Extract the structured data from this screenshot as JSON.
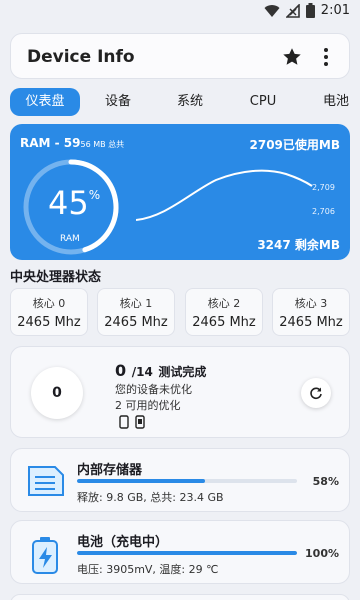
{
  "status_bar": {
    "time": "2:01"
  },
  "app_bar": {
    "title": "Device Info"
  },
  "tabs": [
    {
      "label": "仪表盘",
      "active": true
    },
    {
      "label": "设备",
      "active": false
    },
    {
      "label": "系统",
      "active": false
    },
    {
      "label": "CPU",
      "active": false
    },
    {
      "label": "电池",
      "active": false
    }
  ],
  "ram": {
    "label": "RAM - 59",
    "total_suffix": "56 MB 总共",
    "used_value": "2709",
    "used_unit": "已使用MB",
    "free_value": "3247",
    "free_unit": "剩余MB",
    "percent": "45",
    "percent_sign": "%",
    "gauge_fraction": 0.45,
    "tag": "RAM",
    "axis_top": "2,709",
    "axis_bottom": "2,706"
  },
  "cpu_section": {
    "title": "中央处理器状态",
    "cores": [
      {
        "label": "核心 0",
        "freq": "2465 Mhz"
      },
      {
        "label": "核心 1",
        "freq": "2465 Mhz"
      },
      {
        "label": "核心 2",
        "freq": "2465 Mhz"
      },
      {
        "label": "核心 3",
        "freq": "2465 Mhz"
      }
    ]
  },
  "tests": {
    "circle_value": "0",
    "done_count": "0",
    "total": "/14",
    "done_label": "测试完成",
    "line1": "您的设备未优化",
    "line2": "2 可用的优化"
  },
  "storage": {
    "title": "内部存储器",
    "detail": "释放: 9.8 GB, 总共: 23.4 GB",
    "percent": "58%",
    "fraction": 0.58
  },
  "battery": {
    "title": "电池（充电中）",
    "detail": "电压: 3905mV, 温度: 29 ℃",
    "percent": "100%",
    "fraction": 1.0
  },
  "colors": {
    "accent": "#2a8ae6",
    "background": "#eef0f5"
  }
}
